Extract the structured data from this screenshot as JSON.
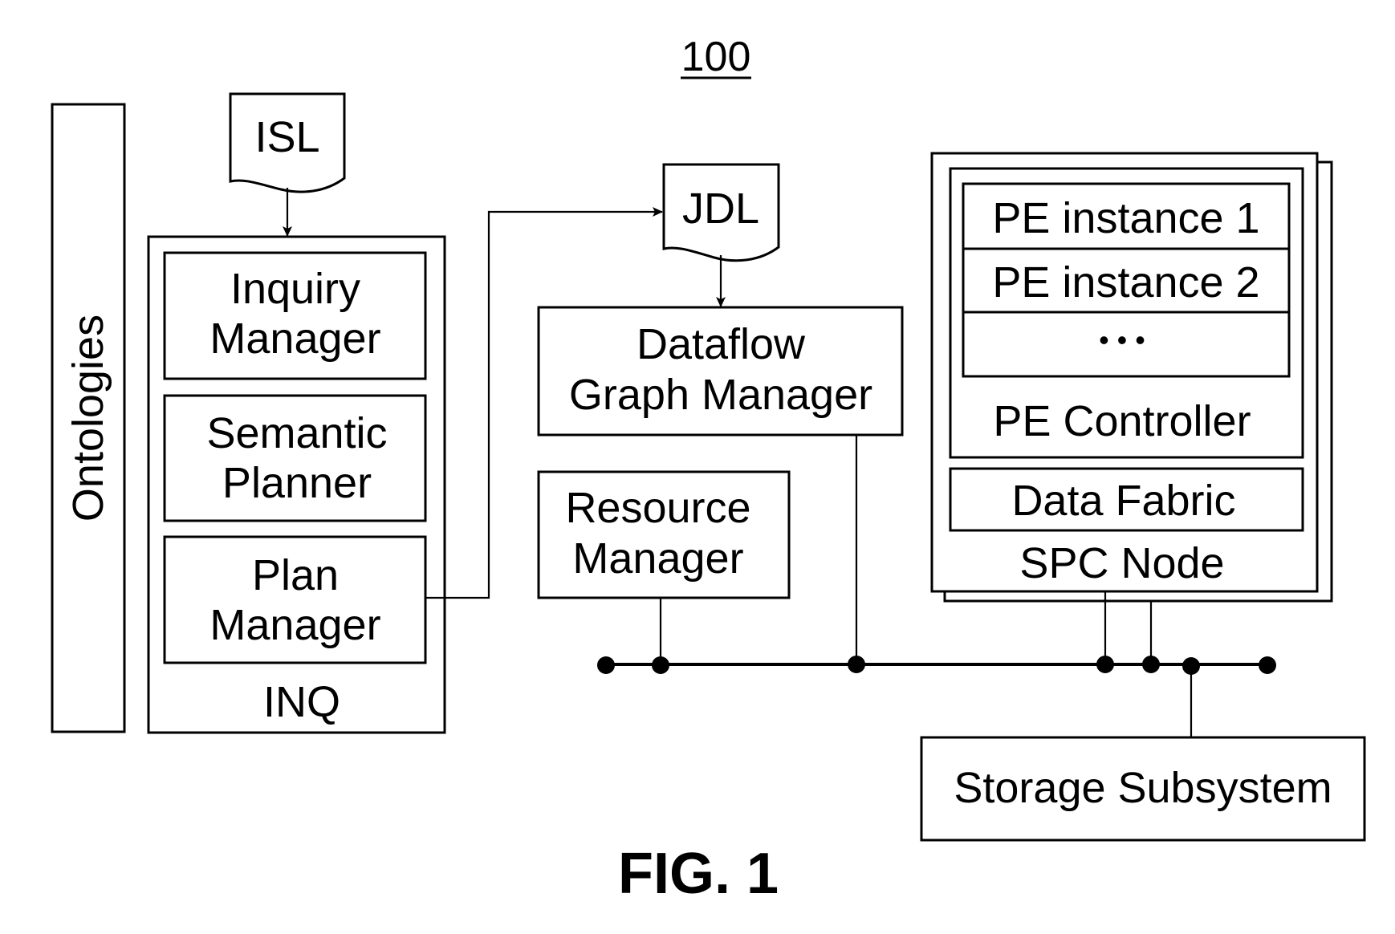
{
  "figure": {
    "reference_number": "100",
    "caption": "FIG. 1"
  },
  "ontologies": {
    "label": "Ontologies"
  },
  "documents": {
    "isl": {
      "label": "ISL"
    },
    "jdl": {
      "label": "JDL"
    }
  },
  "inq": {
    "label": "INQ",
    "components": [
      {
        "line1": "Inquiry",
        "line2": "Manager"
      },
      {
        "line1": "Semantic",
        "line2": "Planner"
      },
      {
        "line1": "Plan",
        "line2": "Manager"
      }
    ]
  },
  "dataflow_graph_manager": {
    "line1": "Dataflow",
    "line2": "Graph Manager"
  },
  "resource_manager": {
    "line1": "Resource",
    "line2": "Manager"
  },
  "spc_node": {
    "label": "SPC Node",
    "pe_controller": {
      "label": "PE Controller",
      "instances": [
        "PE instance 1",
        "PE instance 2",
        "• • •"
      ]
    },
    "data_fabric": {
      "label": "Data Fabric"
    }
  },
  "storage_subsystem": {
    "label": "Storage Subsystem"
  },
  "colors": {
    "ink": "#000000",
    "paper": "#ffffff"
  }
}
